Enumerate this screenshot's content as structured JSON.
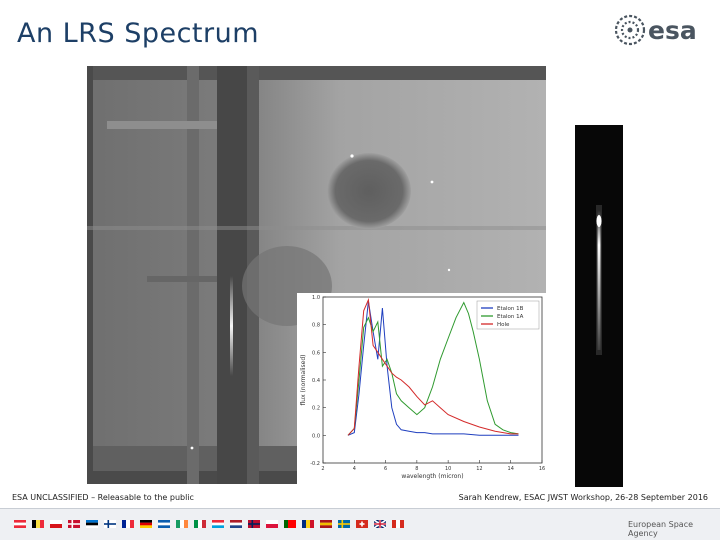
{
  "slide": {
    "title": "An LRS Spectrum",
    "logo_text": "esa",
    "footer_left": "ESA UNCLASSIFIED – Releasable to the public",
    "footer_right": "Sarah Kendrew, ESAC JWST Workshop, 26-28 September 2016",
    "agency_text": "European Space Agency",
    "colors": {
      "title": "#1d3f66",
      "logo": "#4a5560"
    }
  },
  "chart_data": {
    "type": "line",
    "title": "",
    "xlabel": "wavelength (micron)",
    "ylabel": "flux (normalised)",
    "xlim": [
      2,
      16
    ],
    "ylim": [
      -0.2,
      1.0
    ],
    "xticks": [
      2,
      4,
      6,
      8,
      10,
      12,
      14,
      16
    ],
    "yticks": [
      -0.2,
      0.0,
      0.2,
      0.4,
      0.6,
      0.8,
      1.0
    ],
    "legend_position": "top-right",
    "series": [
      {
        "name": "Etalon 1B",
        "color": "#1f3fbf",
        "x": [
          3.6,
          4.0,
          4.3,
          4.6,
          4.9,
          5.2,
          5.5,
          5.8,
          6.1,
          6.4,
          6.7,
          7.0,
          7.5,
          8.0,
          8.5,
          9.0,
          10.0,
          11.0,
          12.0,
          13.0,
          14.0,
          14.5
        ],
        "values": [
          0.0,
          0.02,
          0.3,
          0.65,
          0.97,
          0.75,
          0.55,
          0.92,
          0.5,
          0.2,
          0.08,
          0.04,
          0.03,
          0.02,
          0.02,
          0.01,
          0.01,
          0.01,
          0.0,
          0.0,
          0.0,
          0.0
        ]
      },
      {
        "name": "Etalon 1A",
        "color": "#2f9a2f",
        "x": [
          3.6,
          4.0,
          4.3,
          4.6,
          4.9,
          5.2,
          5.5,
          5.8,
          6.1,
          6.4,
          6.7,
          7.0,
          7.5,
          8.0,
          8.5,
          9.0,
          9.5,
          10.0,
          10.5,
          11.0,
          11.3,
          11.6,
          12.0,
          12.5,
          13.0,
          13.5,
          14.0,
          14.5
        ],
        "values": [
          0.0,
          0.05,
          0.4,
          0.78,
          0.85,
          0.75,
          0.82,
          0.5,
          0.55,
          0.45,
          0.3,
          0.25,
          0.2,
          0.15,
          0.2,
          0.35,
          0.55,
          0.7,
          0.85,
          0.96,
          0.88,
          0.75,
          0.55,
          0.25,
          0.08,
          0.04,
          0.02,
          0.01
        ]
      },
      {
        "name": "Hole",
        "color": "#d42a2a",
        "x": [
          3.6,
          4.0,
          4.3,
          4.6,
          4.9,
          5.2,
          5.5,
          5.8,
          6.1,
          6.4,
          6.7,
          7.0,
          7.5,
          8.0,
          8.5,
          9.0,
          9.5,
          10.0,
          11.0,
          12.0,
          13.0,
          14.0,
          14.5
        ],
        "values": [
          0.0,
          0.05,
          0.5,
          0.9,
          0.98,
          0.65,
          0.6,
          0.55,
          0.5,
          0.45,
          0.42,
          0.4,
          0.35,
          0.28,
          0.22,
          0.25,
          0.2,
          0.15,
          0.1,
          0.06,
          0.03,
          0.01,
          0.01
        ]
      }
    ]
  },
  "flags": [
    {
      "name": "austria-flag",
      "colors": [
        "#ed2939",
        "#ffffff",
        "#ed2939"
      ],
      "dir": "h"
    },
    {
      "name": "belgium-flag",
      "colors": [
        "#000000",
        "#fae042",
        "#ed2939"
      ],
      "dir": "v"
    },
    {
      "name": "czech-flag",
      "colors": [
        "#ffffff",
        "#d7141a"
      ],
      "dir": "h"
    },
    {
      "name": "denmark-flag",
      "colors": [
        "#c8102e",
        "#ffffff"
      ],
      "dir": "c"
    },
    {
      "name": "estonia-flag",
      "colors": [
        "#0072ce",
        "#000000",
        "#ffffff"
      ],
      "dir": "h"
    },
    {
      "name": "finland-flag",
      "colors": [
        "#ffffff",
        "#003580"
      ],
      "dir": "c"
    },
    {
      "name": "france-flag",
      "colors": [
        "#002395",
        "#ffffff",
        "#ed2939"
      ],
      "dir": "v"
    },
    {
      "name": "germany-flag",
      "colors": [
        "#000000",
        "#dd0000",
        "#ffce00"
      ],
      "dir": "h"
    },
    {
      "name": "greece-flag",
      "colors": [
        "#0d5eaf",
        "#ffffff",
        "#0d5eaf"
      ],
      "dir": "h"
    },
    {
      "name": "ireland-flag",
      "colors": [
        "#169b62",
        "#ffffff",
        "#ff883e"
      ],
      "dir": "v"
    },
    {
      "name": "italy-flag",
      "colors": [
        "#009246",
        "#ffffff",
        "#ce2b37"
      ],
      "dir": "v"
    },
    {
      "name": "luxembourg-flag",
      "colors": [
        "#ed2939",
        "#ffffff",
        "#00a1de"
      ],
      "dir": "h"
    },
    {
      "name": "netherlands-flag",
      "colors": [
        "#ae1c28",
        "#ffffff",
        "#21468b"
      ],
      "dir": "h"
    },
    {
      "name": "norway-flag",
      "colors": [
        "#ba0c2f",
        "#00205b"
      ],
      "dir": "c"
    },
    {
      "name": "poland-flag",
      "colors": [
        "#ffffff",
        "#dc143c"
      ],
      "dir": "h"
    },
    {
      "name": "portugal-flag",
      "colors": [
        "#006600",
        "#ff0000",
        "#ff0000"
      ],
      "dir": "v"
    },
    {
      "name": "romania-flag",
      "colors": [
        "#002b7f",
        "#fcd116",
        "#ce1126"
      ],
      "dir": "v"
    },
    {
      "name": "spain-flag",
      "colors": [
        "#aa151b",
        "#f1bf00",
        "#aa151b"
      ],
      "dir": "h"
    },
    {
      "name": "sweden-flag",
      "colors": [
        "#006aa7",
        "#fecc00"
      ],
      "dir": "c"
    },
    {
      "name": "switzerland-flag",
      "colors": [
        "#d52b1e",
        "#ffffff"
      ],
      "dir": "x"
    },
    {
      "name": "uk-flag",
      "colors": [
        "#012169",
        "#ffffff",
        "#c8102e"
      ],
      "dir": "u"
    },
    {
      "name": "canada-flag",
      "colors": [
        "#d52b1e",
        "#ffffff",
        "#d52b1e"
      ],
      "dir": "v"
    }
  ]
}
